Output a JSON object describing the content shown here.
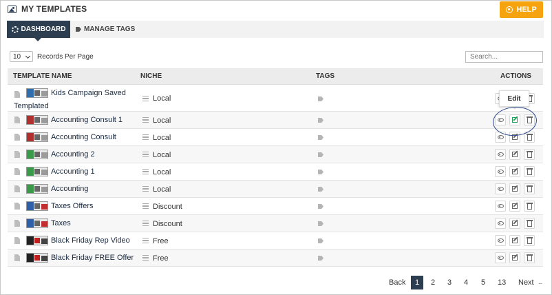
{
  "header": {
    "title": "MY TEMPLATES",
    "help_label": "HELP"
  },
  "tabs": {
    "dashboard": "DASHBOARD",
    "manage_tags": "MANAGE TAGS"
  },
  "controls": {
    "records_value": "10",
    "records_label": "Records Per Page",
    "search_placeholder": "Search..."
  },
  "table": {
    "headers": {
      "name": "TEMPLATE NAME",
      "niche": "NICHE",
      "tags": "TAGS",
      "actions": "ACTIONS"
    },
    "rows": [
      {
        "name": "Kids Campaign Saved",
        "name2": "Templated",
        "niche": "Local"
      },
      {
        "name": "Accounting Consult 1",
        "niche": "Local"
      },
      {
        "name": "Accounting Consult",
        "niche": "Local"
      },
      {
        "name": "Accounting 2",
        "niche": "Local"
      },
      {
        "name": "Accounting 1",
        "niche": "Local"
      },
      {
        "name": "Accounting",
        "niche": "Local"
      },
      {
        "name": "Taxes Offers",
        "niche": "Discount"
      },
      {
        "name": "Taxes",
        "niche": "Discount"
      },
      {
        "name": "Black Friday Rep Video",
        "niche": "Free"
      },
      {
        "name": "Black Friday FREE Offer",
        "niche": "Free"
      }
    ]
  },
  "tooltip": {
    "label": "Edit"
  },
  "pagination": {
    "back": "Back",
    "pages": [
      "1",
      "2",
      "3",
      "4",
      "5",
      "13"
    ],
    "next": "Next",
    "more": "..."
  },
  "colors": {
    "accent_orange": "#f5a30f",
    "navy": "#2c3e50",
    "edit_green": "#22a35a",
    "annotation_blue": "#2f4b8a"
  },
  "icons": {
    "title": "image-icon",
    "help": "circle-icon",
    "dashboard": "cogs-icon",
    "tags": "tag-icon",
    "row_file": "file-icon",
    "niche": "list-icon",
    "view": "eye-icon",
    "edit": "edit-icon",
    "delete": "trash-icon"
  }
}
